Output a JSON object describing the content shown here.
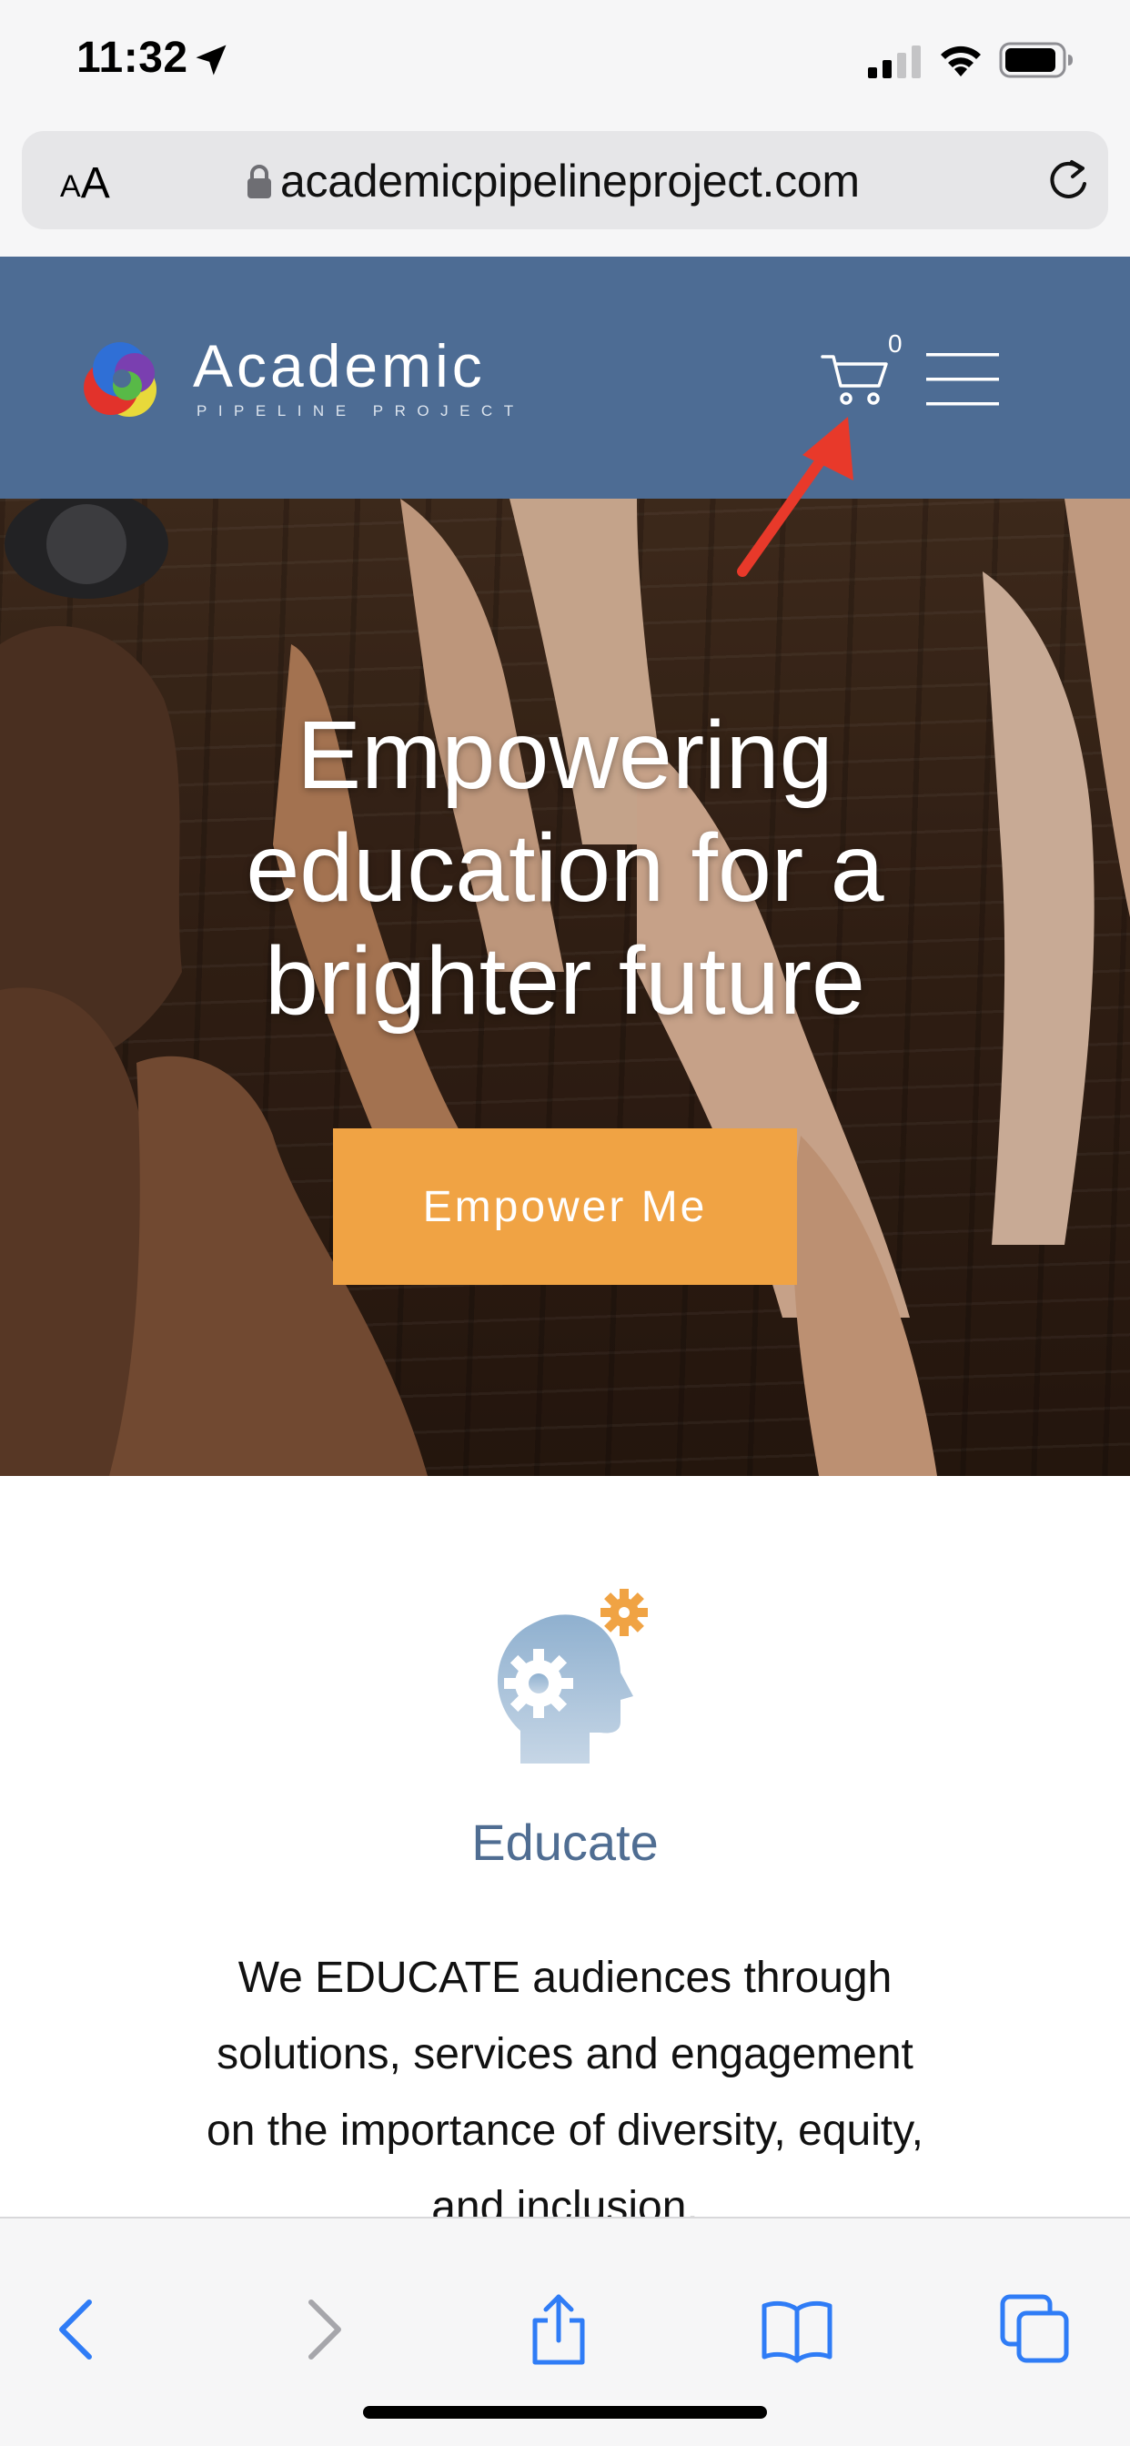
{
  "status_bar": {
    "time": "11:32"
  },
  "browser": {
    "text_size_small": "A",
    "text_size_large": "A",
    "url": "academicpipelineproject.com"
  },
  "site_header": {
    "logo_name": "Academic",
    "logo_tagline": "PIPELINE PROJECT",
    "cart_count": "0"
  },
  "hero": {
    "title": "Empowering education for a brighter future",
    "cta_label": "Empower Me"
  },
  "section": {
    "title": "Educate",
    "body": "We EDUCATE audiences through solutions, services and engagement on the importance of diversity, equity, and inclusion."
  },
  "colors": {
    "header_bg": "#4d6c94",
    "cta": "#f0a344",
    "accent_text": "#4f6d92",
    "toolbar_icon": "#2f7cf6",
    "annotation": "#e8392a"
  },
  "icons": [
    "location-arrow-icon",
    "signal-icon",
    "wifi-icon",
    "battery-icon",
    "lock-icon",
    "reload-icon",
    "cart-icon",
    "hamburger-menu-icon",
    "head-gears-icon",
    "back-icon",
    "forward-icon",
    "share-icon",
    "bookmarks-icon",
    "tabs-icon"
  ]
}
